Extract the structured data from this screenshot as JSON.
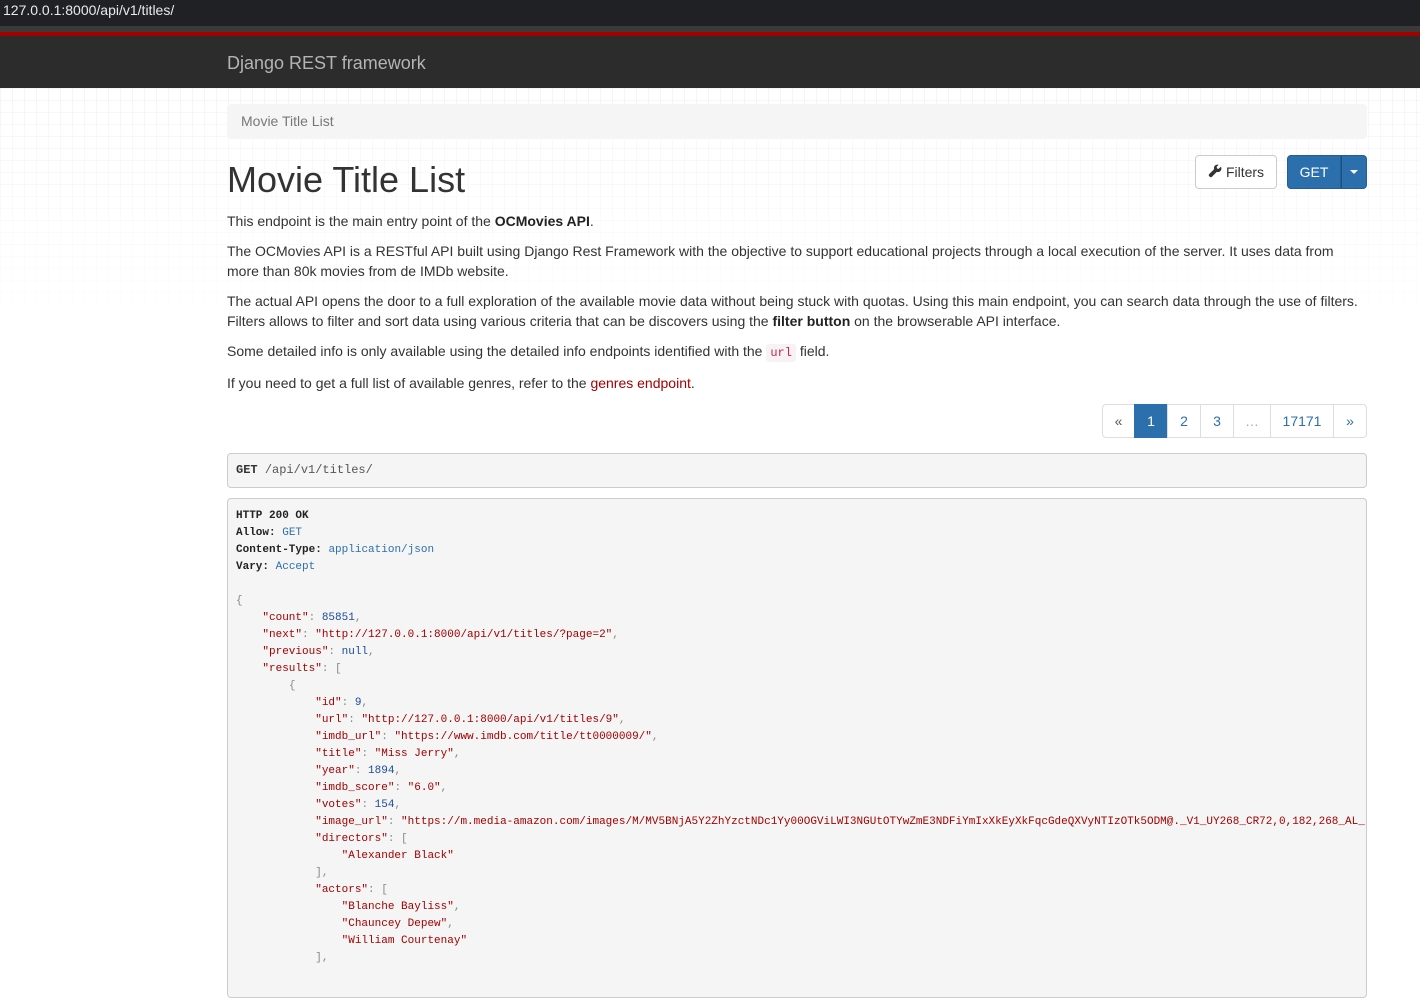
{
  "browser": {
    "url": "127.0.0.1:8000/api/v1/titles/"
  },
  "navbar": {
    "brand": "Django REST framework"
  },
  "breadcrumb": {
    "label": "Movie Title List"
  },
  "header": {
    "title": "Movie Title List",
    "filters_label": "Filters",
    "get_label": "GET"
  },
  "description": {
    "p1_prefix": "This endpoint is the main entry point of the ",
    "p1_bold": "OCMovies API",
    "p1_suffix": ".",
    "p2": "The OCMovies API is a RESTful API built using Django Rest Framework with the objective to support educational projects through a local execution of the server. It uses data from more than 80k movies from de IMDb website.",
    "p3_prefix": "The actual API opens the door to a full exploration of the available movie data without being stuck with quotas. Using this main endpoint, you can search data through the use of filters. Filters allows to filter and sort data using various criteria that can be discovers using the ",
    "p3_bold": "filter button",
    "p3_suffix": " on the browserable API interface.",
    "p4_prefix": "Some detailed info is only available using the detailed info endpoints identified with the ",
    "p4_code": "url",
    "p4_suffix": " field.",
    "p5_prefix": "If you need to get a full list of available genres, refer to the ",
    "p5_link": "genres endpoint",
    "p5_suffix": "."
  },
  "pagination": {
    "prev": "«",
    "pages": [
      "1",
      "2",
      "3"
    ],
    "ellipsis": "…",
    "last": "17171",
    "next": "»",
    "current": "1"
  },
  "request": {
    "method": "GET",
    "path": "/api/v1/titles/"
  },
  "response": {
    "status": "HTTP 200 OK",
    "headers": [
      {
        "key": "Allow:",
        "value": "GET"
      },
      {
        "key": "Content-Type:",
        "value": "application/json"
      },
      {
        "key": "Vary:",
        "value": "Accept"
      }
    ],
    "body": {
      "count": "85851",
      "next": "\"http://127.0.0.1:8000/api/v1/titles/?page=2\"",
      "previous": "null",
      "result": {
        "id": "9",
        "url": "\"http://127.0.0.1:8000/api/v1/titles/9\"",
        "imdb_url": "\"https://www.imdb.com/title/tt0000009/\"",
        "title": "\"Miss Jerry\"",
        "year": "1894",
        "imdb_score": "\"6.0\"",
        "votes": "154",
        "image_url": "\"https://m.media-amazon.com/images/M/MV5BNjA5Y2ZhYzctNDc1Yy00OGViLWI3NGUtOTYwZmE3NDFiYmIxXkEyXkFqcGdeQXVyNTIzOTk5ODM@._V1_UY268_CR72,0,182,268_AL_",
        "directors": [
          "\"Alexander Black\""
        ],
        "actors": [
          "\"Blanche Bayliss\"",
          "\"Chauncey Depew\"",
          "\"William Courtenay\""
        ]
      }
    }
  }
}
